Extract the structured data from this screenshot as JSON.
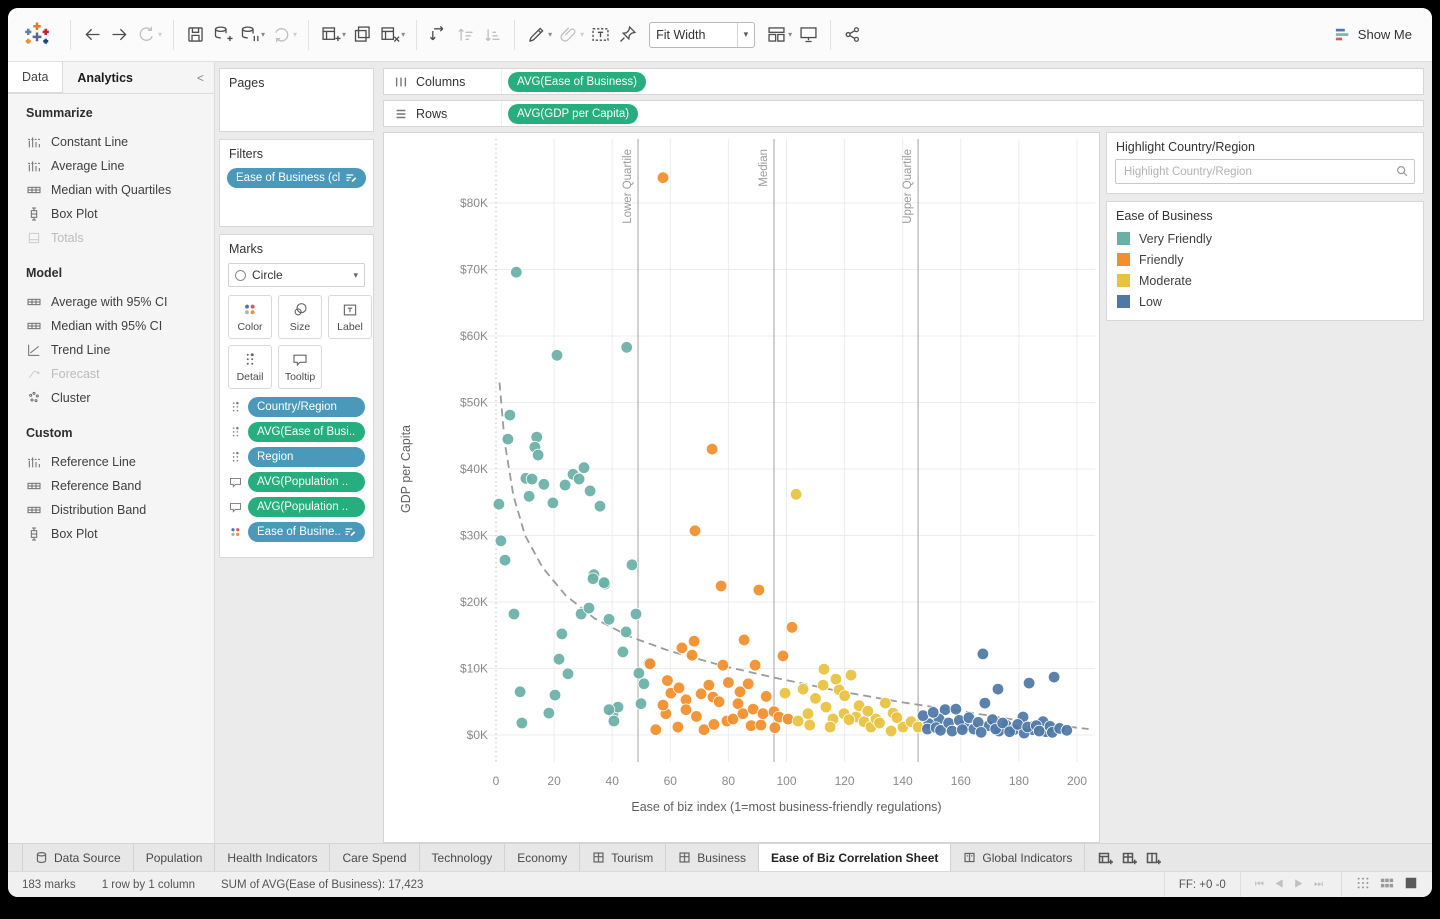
{
  "theme": {
    "pill-green": "#27ae7e",
    "pill-blue": "#4a98ba",
    "accent-teal": "#69b0a7",
    "accent-orange": "#f28e2b",
    "accent-yellow": "#e8c33d",
    "accent-blue": "#4e79a7"
  },
  "toolbar": {
    "groups_left": [
      [
        {
          "icon": "back"
        },
        {
          "icon": "forward"
        },
        {
          "icon": "replay",
          "caret": true,
          "disabled": true
        }
      ],
      [
        {
          "icon": "save"
        },
        {
          "icon": "add-datasource"
        },
        {
          "icon": "pause-datasource",
          "caret": true
        },
        {
          "icon": "refresh",
          "caret": true,
          "disabled": true
        }
      ],
      [
        {
          "icon": "new-worksheet",
          "caret": true
        },
        {
          "icon": "duplicate"
        },
        {
          "icon": "clear-sheet",
          "caret": true
        }
      ],
      [
        {
          "icon": "swap-axes"
        },
        {
          "icon": "sort-asc",
          "disabled": true
        },
        {
          "icon": "sort-desc",
          "disabled": true
        }
      ],
      [
        {
          "icon": "highlight",
          "caret": true
        },
        {
          "icon": "paperclip",
          "caret": true,
          "disabled": true
        },
        {
          "icon": "text-label"
        },
        {
          "icon": "pin"
        }
      ]
    ],
    "fit_value": "Fit Width",
    "groups_right": [
      [
        {
          "icon": "cards",
          "caret": true
        },
        {
          "icon": "presentation"
        }
      ],
      [
        {
          "icon": "share"
        }
      ]
    ],
    "show_me_label": "Show Me"
  },
  "sidebar": {
    "tabs": {
      "data": "Data",
      "analytics": "Analytics"
    },
    "active_tab": "Analytics",
    "sections": [
      {
        "title": "Summarize",
        "items": [
          {
            "label": "Constant Line",
            "icon": "ref-line"
          },
          {
            "label": "Average Line",
            "icon": "ref-line"
          },
          {
            "label": "Median with Quartiles",
            "icon": "band"
          },
          {
            "label": "Box Plot",
            "icon": "boxplot"
          },
          {
            "label": "Totals",
            "icon": "totals",
            "disabled": true
          }
        ]
      },
      {
        "title": "Model",
        "items": [
          {
            "label": "Average with 95% CI",
            "icon": "band"
          },
          {
            "label": "Median with 95% CI",
            "icon": "band"
          },
          {
            "label": "Trend Line",
            "icon": "trend"
          },
          {
            "label": "Forecast",
            "icon": "forecast",
            "disabled": true
          },
          {
            "label": "Cluster",
            "icon": "cluster"
          }
        ]
      },
      {
        "title": "Custom",
        "items": [
          {
            "label": "Reference Line",
            "icon": "ref-line"
          },
          {
            "label": "Reference Band",
            "icon": "band"
          },
          {
            "label": "Distribution Band",
            "icon": "band"
          },
          {
            "label": "Box Plot",
            "icon": "boxplot"
          }
        ]
      }
    ]
  },
  "cards": {
    "pages_title": "Pages",
    "filters_title": "Filters",
    "filter_pills": [
      {
        "label": "Ease of Business (cl..",
        "color": "blue",
        "right_icon": "sort"
      }
    ],
    "marks": {
      "title": "Marks",
      "mark_type": "Circle",
      "buttons": [
        {
          "label": "Color",
          "icon": "color"
        },
        {
          "label": "Size",
          "icon": "size"
        },
        {
          "label": "Label",
          "icon": "label"
        },
        {
          "label": "Detail",
          "icon": "detail"
        },
        {
          "label": "Tooltip",
          "icon": "tooltip"
        }
      ],
      "pills": [
        {
          "icon": "detail",
          "label": "Country/Region",
          "color": "blue"
        },
        {
          "icon": "detail",
          "label": "AVG(Ease of Busi..",
          "color": "green"
        },
        {
          "icon": "detail",
          "label": "Region",
          "color": "blue"
        },
        {
          "icon": "tooltip",
          "label": "AVG(Population ..",
          "color": "green"
        },
        {
          "icon": "tooltip",
          "label": "AVG(Population ..",
          "color": "green"
        },
        {
          "icon": "color",
          "label": "Ease of Busine..",
          "color": "blue",
          "right_icon": "sort"
        }
      ]
    }
  },
  "shelves": {
    "columns_label": "Columns",
    "rows_label": "Rows",
    "columns_pills": [
      {
        "label": "AVG(Ease of Business)",
        "color": "green"
      }
    ],
    "rows_pills": [
      {
        "label": "AVG(GDP per Capita)",
        "color": "green"
      }
    ]
  },
  "highlight_card": {
    "title": "Highlight Country/Region",
    "search_placeholder": "Highlight Country/Region"
  },
  "legend": {
    "title": "Ease of Business",
    "items": [
      {
        "label": "Very Friendly",
        "color": "#69b0a7"
      },
      {
        "label": "Friendly",
        "color": "#f28e2b"
      },
      {
        "label": "Moderate",
        "color": "#e8c33d"
      },
      {
        "label": "Low",
        "color": "#4e79a7"
      }
    ]
  },
  "chart_data": {
    "type": "scatter",
    "xlabel": "Ease of biz index (1=most business-friendly regulations)",
    "ylabel": "GDP per Capita",
    "x_ticks": [
      0,
      20,
      40,
      60,
      80,
      100,
      120,
      140,
      160,
      180,
      200
    ],
    "y_ticks_k": [
      0,
      10,
      20,
      30,
      40,
      50,
      60,
      70,
      80
    ],
    "y_tick_labels": [
      "$0K",
      "$10K",
      "$20K",
      "$30K",
      "$40K",
      "$50K",
      "$60K",
      "$70K",
      "$80K"
    ],
    "xlim": [
      -10,
      208
    ],
    "ylim_thousands": [
      -4.5,
      90.5
    ],
    "grid": true,
    "reference_lines": [
      {
        "label": "Lower Quartile",
        "x": 48.9
      },
      {
        "label": "Median",
        "x": 95.7
      },
      {
        "label": "Upper Quartile",
        "x": 145.3
      }
    ],
    "trend_line": {
      "style": "dashed",
      "points_k": [
        [
          1.2,
          53
        ],
        [
          3,
          44
        ],
        [
          6,
          36
        ],
        [
          10,
          30
        ],
        [
          16,
          25.2
        ],
        [
          24,
          21
        ],
        [
          34,
          17.5
        ],
        [
          46,
          14.8
        ],
        [
          60,
          12.6
        ],
        [
          78,
          10.4
        ],
        [
          96,
          8.6
        ],
        [
          118,
          6.6
        ],
        [
          140,
          4.9
        ],
        [
          160,
          3.6
        ],
        [
          180,
          2.2
        ],
        [
          196,
          1.3
        ],
        [
          204,
          0.9
        ]
      ]
    },
    "y_units": "thousands of USD",
    "series": [
      {
        "name": "Very Friendly",
        "color": "#69b0a7",
        "points": [
          [
            7,
            69.6
          ],
          [
            21,
            57.1
          ],
          [
            45,
            58.3
          ],
          [
            4.8,
            48.1
          ],
          [
            4.1,
            44.5
          ],
          [
            14,
            44.8
          ],
          [
            13.4,
            43.3
          ],
          [
            14.5,
            42.1
          ],
          [
            10.3,
            38.6
          ],
          [
            12.4,
            38.5
          ],
          [
            16.5,
            37.7
          ],
          [
            11.4,
            35.9
          ],
          [
            19.6,
            34.9
          ],
          [
            23.8,
            37.6
          ],
          [
            26.5,
            39.2
          ],
          [
            28.6,
            38.5
          ],
          [
            30.3,
            40.2
          ],
          [
            32.4,
            36.7
          ],
          [
            35.8,
            34.4
          ],
          [
            1,
            34.7
          ],
          [
            1.7,
            29.2
          ],
          [
            3.1,
            26.3
          ],
          [
            33.7,
            24.1
          ],
          [
            37.5,
            22.7
          ],
          [
            46.8,
            25.6
          ],
          [
            6.2,
            18.2
          ],
          [
            8.3,
            6.5
          ],
          [
            8.9,
            1.8
          ],
          [
            18.2,
            3.3
          ],
          [
            20.3,
            6
          ],
          [
            22.7,
            15.2
          ],
          [
            21.7,
            11.4
          ],
          [
            24.8,
            9.2
          ],
          [
            29.3,
            18.2
          ],
          [
            33.4,
            23.5
          ],
          [
            37.2,
            22.9
          ],
          [
            32,
            19.1
          ],
          [
            38.9,
            17.4
          ],
          [
            44.8,
            15.5
          ],
          [
            43.7,
            12.5
          ],
          [
            48.2,
            18.2
          ],
          [
            49.2,
            9.3
          ],
          [
            50.9,
            7.7
          ],
          [
            49.9,
            4.7
          ],
          [
            40.3,
            3.3
          ],
          [
            42,
            4.2
          ],
          [
            38.9,
            3.8
          ],
          [
            40.6,
            2.1
          ],
          [
            52.7,
            10.8
          ]
        ]
      },
      {
        "name": "Friendly",
        "color": "#f28e2b",
        "points": [
          [
            57.5,
            83.8
          ],
          [
            74.4,
            43
          ],
          [
            68.5,
            30.7
          ],
          [
            77.5,
            22.4
          ],
          [
            90.5,
            21.8
          ],
          [
            101.9,
            16.2
          ],
          [
            68.2,
            14.1
          ],
          [
            64,
            13.1
          ],
          [
            67.5,
            12
          ],
          [
            85.4,
            14.3
          ],
          [
            98.8,
            11.9
          ],
          [
            89.2,
            10.5
          ],
          [
            78.1,
            10.5
          ],
          [
            86.8,
            7.7
          ],
          [
            53,
            10.7
          ],
          [
            55,
            0.8
          ],
          [
            58.5,
            3.2
          ],
          [
            62.6,
            1.2
          ],
          [
            65.4,
            5.3
          ],
          [
            60.2,
            6.3
          ],
          [
            57.5,
            4.5
          ],
          [
            65.4,
            3.8
          ],
          [
            70.6,
            6.2
          ],
          [
            73.3,
            7.5
          ],
          [
            74.7,
            5.7
          ],
          [
            76.8,
            5
          ],
          [
            71.6,
            0.8
          ],
          [
            79.5,
            2.1
          ],
          [
            81.6,
            2.4
          ],
          [
            83.3,
            4.7
          ],
          [
            85,
            3.2
          ],
          [
            87.8,
            1.4
          ],
          [
            91.2,
            1.5
          ],
          [
            88.5,
            3.9
          ],
          [
            91.9,
            3.2
          ],
          [
            95.7,
            3.5
          ],
          [
            97.4,
            2.7
          ],
          [
            100.5,
            2.4
          ],
          [
            59,
            8.2
          ],
          [
            63,
            7.1
          ],
          [
            69,
            2.8
          ],
          [
            75,
            1.6
          ],
          [
            80,
            7.9
          ],
          [
            84,
            6.5
          ],
          [
            93,
            5.8
          ],
          [
            96,
            1.1
          ]
        ]
      },
      {
        "name": "Moderate",
        "color": "#e8c33d",
        "points": [
          [
            103.3,
            36.2
          ],
          [
            122.2,
            9
          ],
          [
            123.9,
            2.7
          ],
          [
            105.7,
            6.9
          ],
          [
            107.4,
            3.2
          ],
          [
            112.6,
            7.5
          ],
          [
            113.6,
            4.2
          ],
          [
            116,
            2.4
          ],
          [
            118.1,
            6.8
          ],
          [
            119.8,
            3.2
          ],
          [
            121.5,
            2.3
          ],
          [
            126.7,
            2
          ],
          [
            129.1,
            1.2
          ],
          [
            130.8,
            2.4
          ],
          [
            136.7,
            3.3
          ],
          [
            136,
            0.6
          ],
          [
            140.1,
            1.2
          ],
          [
            142.9,
            2
          ],
          [
            145.3,
            1.2
          ],
          [
            112.9,
            9.9
          ],
          [
            108,
            1.5
          ],
          [
            110,
            5.5
          ],
          [
            115,
            1.2
          ],
          [
            120,
            5.9
          ],
          [
            125,
            4.4
          ],
          [
            128,
            3.6
          ],
          [
            132,
            1.8
          ],
          [
            134,
            4.8
          ],
          [
            138,
            2.6
          ],
          [
            99.5,
            6.3
          ],
          [
            104,
            2.1
          ],
          [
            117,
            8.4
          ]
        ]
      },
      {
        "name": "Low",
        "color": "#4e79a7",
        "points": [
          [
            167.6,
            12.2
          ],
          [
            192.1,
            8.7
          ],
          [
            172.8,
            6.9
          ],
          [
            183.5,
            7.8
          ],
          [
            168.3,
            4.8
          ],
          [
            181.4,
            2.7
          ],
          [
            154.6,
            3.8
          ],
          [
            158.3,
            3.9
          ],
          [
            152.5,
            2.4
          ],
          [
            149,
            1.7
          ],
          [
            161.1,
            1.5
          ],
          [
            164.5,
            0.9
          ],
          [
            169.7,
            1.4
          ],
          [
            175.6,
            1.5
          ],
          [
            178.3,
            0.8
          ],
          [
            184.8,
            0.8
          ],
          [
            188.3,
            2
          ],
          [
            189.3,
            0.5
          ],
          [
            181.8,
            0.3
          ],
          [
            173.1,
            0.6
          ],
          [
            147,
            2.9
          ],
          [
            148.5,
            0.9
          ],
          [
            150.5,
            3.4
          ],
          [
            151.5,
            1.1
          ],
          [
            153,
            0.7
          ],
          [
            155.8,
            1.8
          ],
          [
            157,
            0.6
          ],
          [
            159.5,
            2.2
          ],
          [
            160.5,
            0.8
          ],
          [
            162.8,
            2.6
          ],
          [
            166,
            1.9
          ],
          [
            167,
            0.4
          ],
          [
            170.9,
            2.3
          ],
          [
            172,
            0.9
          ],
          [
            174.4,
            1.8
          ],
          [
            176.8,
            0.5
          ],
          [
            179.6,
            1.6
          ],
          [
            183,
            1.2
          ],
          [
            186,
            1.4
          ],
          [
            187,
            0.6
          ],
          [
            190.7,
            1.3
          ],
          [
            191.5,
            0.4
          ],
          [
            194,
            1
          ],
          [
            196.5,
            0.7
          ]
        ]
      }
    ]
  },
  "sheet_tabs": {
    "tabs": [
      {
        "label": "Data Source",
        "icon": "datasource"
      },
      {
        "label": "Population"
      },
      {
        "label": "Health Indicators"
      },
      {
        "label": "Care Spend"
      },
      {
        "label": "Technology"
      },
      {
        "label": "Economy"
      },
      {
        "label": "Tourism",
        "icon": "dashboard"
      },
      {
        "label": "Business",
        "icon": "dashboard"
      },
      {
        "label": "Ease of Biz Correlation Sheet",
        "active": true
      },
      {
        "label": "Global Indicators",
        "icon": "story"
      }
    ],
    "new_buttons": [
      {
        "name": "new-worksheet",
        "icon": "new-worksheet"
      },
      {
        "name": "new-dashboard",
        "icon": "new-dashboard"
      },
      {
        "name": "new-story",
        "icon": "new-story"
      }
    ]
  },
  "status_bar": {
    "marks_count": "183 marks",
    "grid_summary": "1 row by 1 column",
    "aggregate_summary": "SUM of AVG(Ease of Business): 17,423",
    "ff": "FF: +0 -0"
  }
}
